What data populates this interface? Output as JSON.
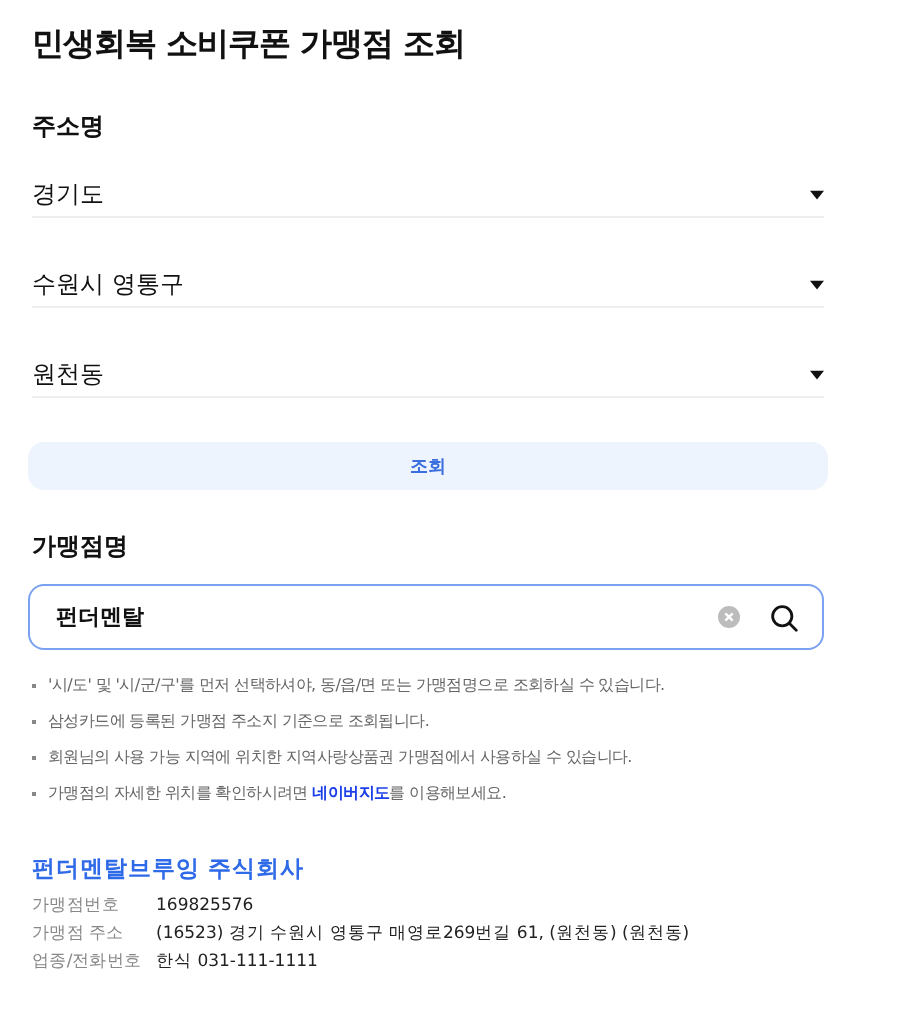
{
  "title": "민생회복 소비쿠폰 가맹점 조회",
  "address": {
    "label": "주소명",
    "selects": [
      {
        "value": "경기도"
      },
      {
        "value": "수원시 영통구"
      },
      {
        "value": "원천동"
      }
    ]
  },
  "search_button": "조회",
  "merchant": {
    "label": "가맹점명",
    "value": "펀더멘탈",
    "clear": true
  },
  "notes": [
    {
      "text": "'시/도' 및 '시/군/구'를 먼저 선택하셔야, 동/읍/면 또는 가맹점명으로 조회하실 수 있습니다."
    },
    {
      "text": "삼성카드에 등록된 가맹점 주소지 기준으로 조회됩니다."
    },
    {
      "text": "회원님의 사용 가능 지역에 위치한 지역사랑상품권 가맹점에서 사용하실 수 있습니다."
    },
    {
      "text": "가맹점의 자세한 위치를 확인하시려면 ",
      "link": "네이버지도",
      "after": "를 이용해보세요."
    }
  ],
  "result": {
    "name": "펀더멘탈브루잉 주식회사",
    "fields": [
      {
        "label": "가맹점번호",
        "value": "169825576"
      },
      {
        "label": "가맹점 주소",
        "value": "(16523) 경기 수원시 영통구 매영로269번길 61, (원천동) (원천동)"
      },
      {
        "label": "업종/전화번호",
        "value": "한식 031-111-1111"
      }
    ]
  }
}
